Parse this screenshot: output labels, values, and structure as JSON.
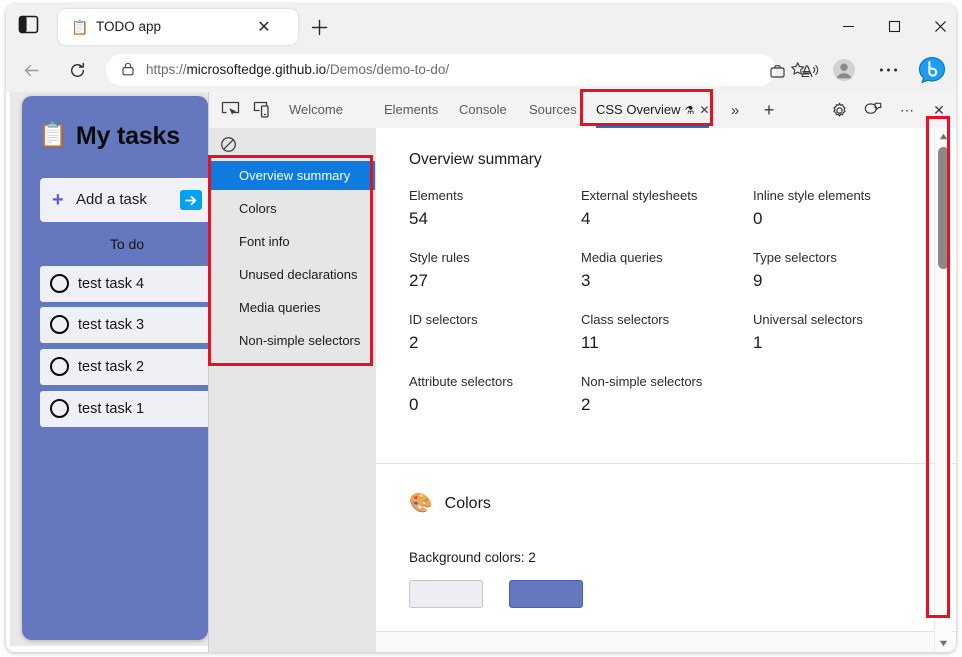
{
  "browser": {
    "tab": {
      "title": "TODO app",
      "favicon": "clipboard-icon",
      "close": "✕"
    },
    "new_tab": "+",
    "window_controls": {
      "minimize": "–",
      "maximize": "□",
      "close": "✕"
    },
    "nav": {
      "back": "←",
      "reload": "⟳"
    },
    "url": {
      "prefix": "https://",
      "domain": "microsoftedge.github.io",
      "path": "/Demos/demo-to-do/",
      "lock": "lock-icon"
    },
    "toolbar_icons": {
      "collections": "briefcase-icon",
      "read_aloud": "read-aloud-icon",
      "favorite": "star-filled-icon",
      "add_favorite": "star-list-icon",
      "profile": "profile-avatar-icon",
      "more": "⋯",
      "copilot": "bing-copilot-icon"
    }
  },
  "page": {
    "app_title": "My tasks",
    "app_icon": "clipboard-icon",
    "add_task": {
      "label": "Add a task",
      "plus": "+",
      "submit": "➜"
    },
    "section_title": "To do",
    "tasks": [
      {
        "label": "test task 4"
      },
      {
        "label": "test task 3"
      },
      {
        "label": "test task 2"
      },
      {
        "label": "test task 1"
      }
    ]
  },
  "devtools": {
    "icons": {
      "inspect": "inspect-element-icon",
      "device": "device-toolbar-icon"
    },
    "tabs": [
      {
        "label": "Welcome",
        "active": false
      },
      {
        "label": "Elements",
        "active": false
      },
      {
        "label": "Console",
        "active": false
      },
      {
        "label": "Sources",
        "active": false
      },
      {
        "label": "CSS Overview",
        "active": true,
        "experimental": "⚗",
        "close": "✕"
      }
    ],
    "tab_overflow": "»",
    "add_tab": "+",
    "right_icons": {
      "settings": "gear-icon",
      "feedback": "feedback-icon",
      "more": "⋯",
      "close": "✕"
    },
    "css_overview": {
      "clear_icon": "clear-overview-icon",
      "sidebar": [
        {
          "label": "Overview summary",
          "selected": true
        },
        {
          "label": "Colors",
          "selected": false
        },
        {
          "label": "Font info",
          "selected": false
        },
        {
          "label": "Unused declarations",
          "selected": false
        },
        {
          "label": "Media queries",
          "selected": false
        },
        {
          "label": "Non-simple selectors",
          "selected": false
        }
      ],
      "summary_title": "Overview summary",
      "stats": [
        {
          "label": "Elements",
          "value": "54"
        },
        {
          "label": "External stylesheets",
          "value": "4"
        },
        {
          "label": "Inline style elements",
          "value": "0"
        },
        {
          "label": "Style rules",
          "value": "27"
        },
        {
          "label": "Media queries",
          "value": "3"
        },
        {
          "label": "Type selectors",
          "value": "9"
        },
        {
          "label": "ID selectors",
          "value": "2"
        },
        {
          "label": "Class selectors",
          "value": "11"
        },
        {
          "label": "Universal selectors",
          "value": "1"
        },
        {
          "label": "Attribute selectors",
          "value": "0"
        },
        {
          "label": "Non-simple selectors",
          "value": "2"
        }
      ],
      "colors_section": {
        "icon": "palette-icon",
        "title": "Colors",
        "background_colors_label": "Background colors: 2",
        "swatches": [
          "#eceef4",
          "#6578bf"
        ]
      }
    },
    "scrollbar": {
      "up": "▲",
      "down": "▼"
    }
  },
  "annotations": {
    "highlight_color": "#e81123"
  }
}
